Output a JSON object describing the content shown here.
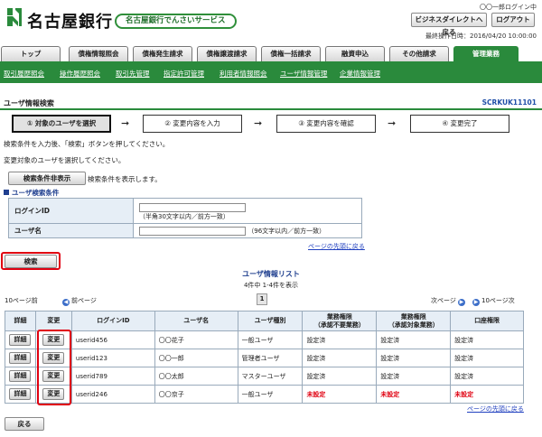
{
  "header": {
    "bank_name": "名古屋銀行",
    "logo_text": "Bank of NAGOYA",
    "service_name": "名古屋銀行でんさいサービス",
    "login_status": "〇〇一郎ログイン中",
    "home_button": "ビジネスダイレクトへ戻る",
    "logout_button": "ログアウト",
    "last_operation": "最終操作日時：2016/04/20 10:00:00"
  },
  "tabs": [
    "トップ",
    "債権情報照会",
    "債権発生請求",
    "債権譲渡請求",
    "債権一括請求",
    "融資申込",
    "その他請求",
    "管理業務"
  ],
  "active_tab_index": 7,
  "subnav": [
    "取引履歴照会",
    "操作履歴照会",
    "取引先管理",
    "指定許可管理",
    "利用者情報照会",
    "ユーザ情報管理",
    "企業情報管理"
  ],
  "page": {
    "title": "ユーザ情報検索",
    "screen_id": "SCRKUK11101"
  },
  "steps": [
    "① 対象のユーザを選択",
    "② 変更内容を入力",
    "③ 変更内容を確認",
    "④ 変更完了"
  ],
  "instructions": {
    "line1": "検索条件を入力後、「検索」ボタンを押してください。",
    "line2": "変更対象のユーザを選択してください。"
  },
  "toggle": {
    "button": "検索条件非表示",
    "note": "検索条件を表示します。"
  },
  "search": {
    "section_title": "ユーザ検索条件",
    "login_id_label": "ログインID",
    "login_id_hint": "（半角30文字以内／前方一致）",
    "username_label": "ユーザ名",
    "username_hint": "（96文字以内／前方一致）",
    "top_link": "ページの先頭に戻る",
    "search_button": "検索"
  },
  "list": {
    "title": "ユーザ情報リスト",
    "count": "4件中 1-4件を表示",
    "prev10": "10ページ前",
    "prev": "前ページ",
    "page": "1",
    "next": "次ページ",
    "next10": "10ページ次",
    "headers": [
      "詳細",
      "変更",
      "ログインID",
      "ユーザ名",
      "ユーザ種別",
      "業務権限\n（承認不要業務）",
      "業務権限\n（承認対象業務）",
      "口座権限"
    ],
    "detail_button": "詳細",
    "change_button": "変更",
    "rows": [
      {
        "login_id": "userid456",
        "username": "〇〇花子",
        "type": "一般ユーザ",
        "auth_free": "設定済",
        "auth_approval": "設定済",
        "account": "設定済",
        "unset": false
      },
      {
        "login_id": "userid123",
        "username": "〇〇一郎",
        "type": "管理者ユーザ",
        "auth_free": "設定済",
        "auth_approval": "設定済",
        "account": "設定済",
        "unset": false
      },
      {
        "login_id": "userid789",
        "username": "〇〇太郎",
        "type": "マスターユーザ",
        "auth_free": "設定済",
        "auth_approval": "設定済",
        "account": "設定済",
        "unset": false
      },
      {
        "login_id": "userid246",
        "username": "〇〇京子",
        "type": "一般ユーザ",
        "auth_free": "未設定",
        "auth_approval": "未設定",
        "account": "未設定",
        "unset": true
      }
    ],
    "top_link": "ページの先頭に戻る"
  },
  "back_button": "戻る",
  "colors": {
    "accent": "#2a8a3c",
    "highlight": "#e00010",
    "link": "#1f3fbf"
  }
}
